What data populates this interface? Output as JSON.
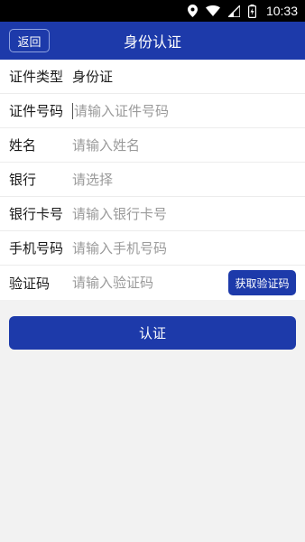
{
  "status_bar": {
    "time": "10:33",
    "icons": [
      "location-icon",
      "wifi-icon",
      "signal-icon",
      "battery-icon"
    ]
  },
  "header": {
    "back_label": "返回",
    "title": "身份认证"
  },
  "form": {
    "rows": [
      {
        "label": "证件类型",
        "value": "身份证"
      },
      {
        "label": "证件号码",
        "placeholder": "请输入证件号码"
      },
      {
        "label": "姓名",
        "placeholder": "请输入姓名"
      },
      {
        "label": "银行",
        "placeholder": "请选择"
      },
      {
        "label": "银行卡号",
        "placeholder": "请输入银行卡号"
      },
      {
        "label": "手机号码",
        "placeholder": "请输入手机号码"
      },
      {
        "label": "验证码",
        "placeholder": "请输入验证码"
      }
    ],
    "code_button": "获取验证码"
  },
  "submit_label": "认证",
  "colors": {
    "primary": "#1d3aaa",
    "background": "#f2f2f2"
  }
}
